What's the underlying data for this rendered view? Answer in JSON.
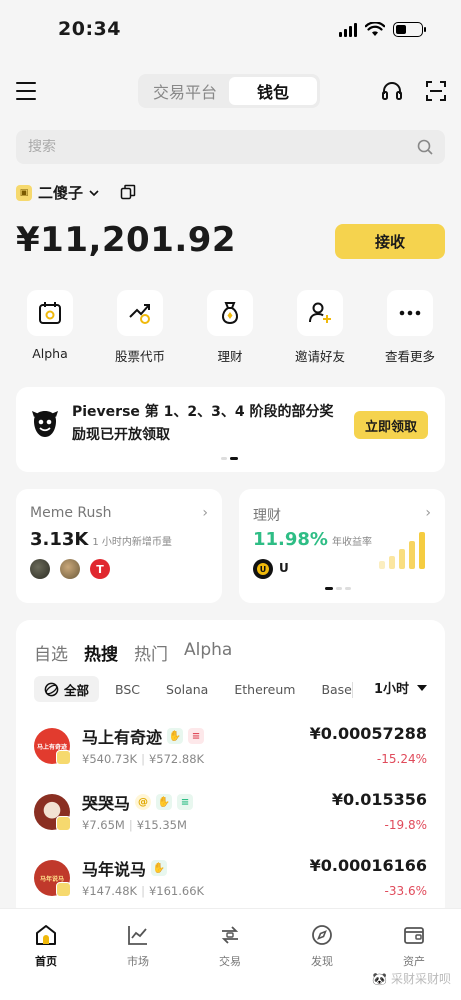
{
  "status": {
    "time": "20:34"
  },
  "header": {
    "tabs": [
      {
        "label": "交易平台",
        "active": false
      },
      {
        "label": "钱包",
        "active": true
      }
    ]
  },
  "search": {
    "placeholder": "搜索"
  },
  "account": {
    "name": "二傻子",
    "balance": "¥11,201.92",
    "receive_label": "接收"
  },
  "quick_actions": [
    {
      "label": "Alpha",
      "icon": "alpha-calendar-icon"
    },
    {
      "label": "股票代币",
      "icon": "stock-token-icon"
    },
    {
      "label": "理财",
      "icon": "finance-bag-icon"
    },
    {
      "label": "邀请好友",
      "icon": "invite-friend-icon"
    },
    {
      "label": "查看更多",
      "icon": "more-icon"
    }
  ],
  "banner": {
    "text": "Pieverse 第 1、2、3、4 阶段的部分奖励现已开放领取",
    "button": "立即领取"
  },
  "cards": {
    "meme": {
      "title": "Meme Rush",
      "value": "3.13K",
      "sub": "1 小时内新增币量"
    },
    "finance": {
      "title": "理财",
      "value": "11.98%",
      "sub": "年收益率",
      "coin_label": "U"
    }
  },
  "market": {
    "tabs": [
      {
        "label": "自选",
        "active": false
      },
      {
        "label": "热搜",
        "active": true
      },
      {
        "label": "热门",
        "active": false
      },
      {
        "label": "Alpha",
        "active": false
      }
    ],
    "chains": [
      {
        "label": "全部",
        "active": true
      },
      {
        "label": "BSC"
      },
      {
        "label": "Solana"
      },
      {
        "label": "Ethereum"
      },
      {
        "label": "Base"
      }
    ],
    "time_filter": "1小时",
    "rows": [
      {
        "name": "马上有奇迹",
        "vol": "¥540.73K",
        "cap": "¥572.88K",
        "price": "¥0.00057288",
        "change": "-15.24%",
        "avatar_color": "#e23b2e",
        "avatar_text": "马上有奇迹"
      },
      {
        "name": "哭哭马",
        "vol": "¥7.65M",
        "cap": "¥15.35M",
        "price": "¥0.015356",
        "change": "-19.8%",
        "avatar_color": "#7a3b2a",
        "avatar_text": ""
      },
      {
        "name": "马年说马",
        "vol": "¥147.48K",
        "cap": "¥161.66K",
        "price": "¥0.00016166",
        "change": "-33.6%",
        "avatar_color": "#c0392b",
        "avatar_text": "马年说马"
      }
    ]
  },
  "nav": [
    {
      "label": "首页",
      "icon": "home-icon",
      "active": true
    },
    {
      "label": "市场",
      "icon": "market-chart-icon"
    },
    {
      "label": "交易",
      "icon": "trade-swap-icon"
    },
    {
      "label": "发现",
      "icon": "discover-icon"
    },
    {
      "label": "资产",
      "icon": "wallet-icon"
    }
  ],
  "watermark": "🐼 采财采财呗",
  "colors": {
    "accent": "#f5d34e",
    "positive": "#2ebd85",
    "negative": "#e04b5b"
  }
}
